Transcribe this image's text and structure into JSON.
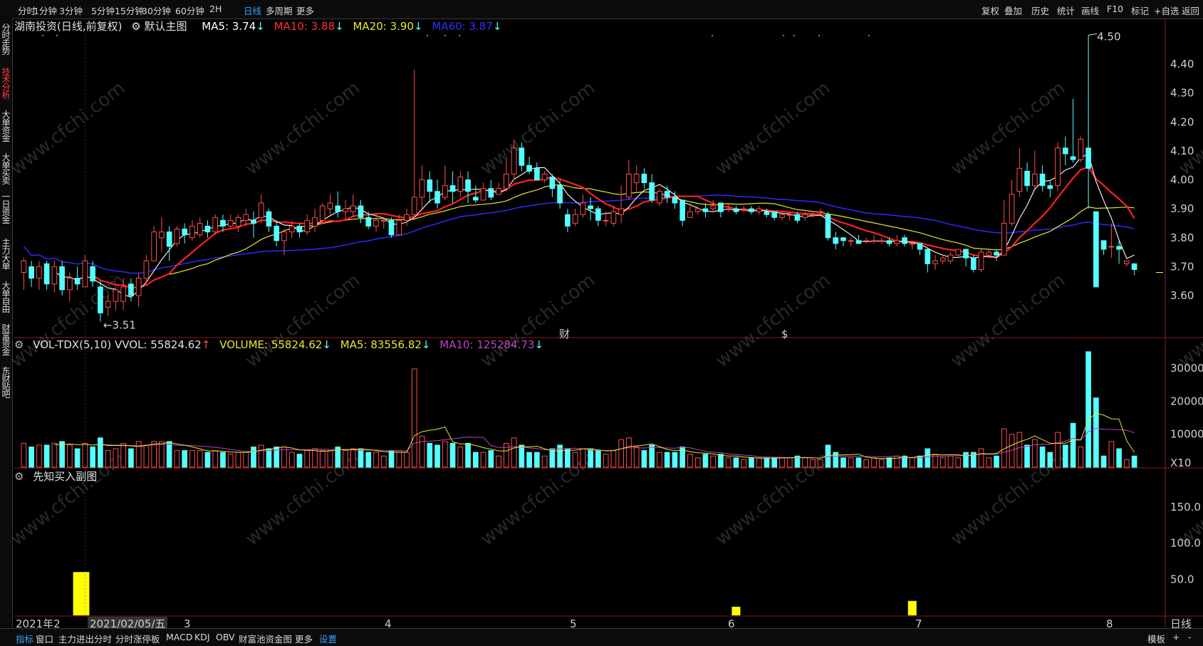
{
  "toolbar_left": [
    {
      "label": "分时",
      "active": false
    },
    {
      "label": "1分钟",
      "active": false
    },
    {
      "label": "3分钟",
      "active": false
    },
    {
      "label": "5分钟",
      "active": false
    },
    {
      "label": "15分钟",
      "active": false
    },
    {
      "label": "30分钟",
      "active": false
    },
    {
      "label": "60分钟",
      "active": false
    },
    {
      "label": "2H",
      "active": false
    },
    {
      "label": "日线",
      "active": true
    },
    {
      "label": "多周期",
      "active": false
    },
    {
      "label": "更多",
      "active": false
    }
  ],
  "toolbar_right": [
    "复权",
    "叠加",
    "历史",
    "统计",
    "画线",
    "F10",
    "标记",
    "+自选",
    "返回"
  ],
  "left_tabs": [
    {
      "label": "分时走势",
      "active": false
    },
    {
      "label": "技术分析",
      "active": true
    },
    {
      "label": "大单资金",
      "active": false
    },
    {
      "label": "大单买卖",
      "active": false
    },
    {
      "label": "一日资金",
      "active": false
    },
    {
      "label": "主力大单",
      "active": false
    },
    {
      "label": "大单自由",
      "active": false
    },
    {
      "label": "财富资金",
      "active": false
    },
    {
      "label": "东财贴吧",
      "active": false
    }
  ],
  "main_legend": {
    "stock": "湖南投资(日线,前复权)",
    "template": "默认主图",
    "ma5": "MA5: 3.74",
    "ma10": "MA10: 3.88",
    "ma20": "MA20: 3.90",
    "ma60": "MA60: 3.87"
  },
  "vol_legend": {
    "name": "VOL-TDX(5,10) VVOL: 55824.62",
    "volume": "VOLUME: 55824.62",
    "ma5": "MA5: 83556.82",
    "ma10": "MA10: 125284.73"
  },
  "sub_legend": {
    "name": "先知买入副图"
  },
  "price_axis": [
    "4.40",
    "4.30",
    "4.20",
    "4.10",
    "4.00",
    "3.90",
    "3.80",
    "3.70",
    "3.60"
  ],
  "vol_axis": [
    "30000",
    "20000",
    "10000",
    "X10"
  ],
  "sub_axis": [
    "150.0",
    "100.0",
    "50.0"
  ],
  "x_axis": [
    "2021年2",
    "2021/02/05/五",
    "3",
    "4",
    "5",
    "6",
    "7",
    "8"
  ],
  "annotations": {
    "high": "4.50",
    "low": "3.51",
    "event1": "财",
    "event2": "$"
  },
  "period_label": "日线",
  "bottom_tabs": [
    {
      "label": "指标",
      "blue": true
    },
    {
      "label": "窗口",
      "blue": false
    },
    {
      "label": "主力进出分时",
      "blue": false
    },
    {
      "label": "分时涨停板",
      "blue": false
    },
    {
      "label": "MACD",
      "blue": false
    },
    {
      "label": "KDJ",
      "blue": false
    },
    {
      "label": "OBV",
      "blue": false
    },
    {
      "label": "财富池资金图",
      "blue": false
    },
    {
      "label": "更多",
      "blue": false
    },
    {
      "label": "设置",
      "blue": true
    }
  ],
  "bottom_right": [
    "模板",
    "+",
    "-"
  ],
  "watermark": "www.cfchi.com",
  "colors": {
    "up": "#ff4d4d",
    "down": "#54ffff",
    "ma5": "#ffffff",
    "ma10": "#ff2020",
    "ma20": "#e6e62e",
    "ma60": "#2a2aff",
    "buy": "#ffff00",
    "vma10": "#c040c0"
  },
  "chart_data": {
    "type": "candlestick",
    "price_range": [
      3.51,
      4.5
    ],
    "candles": [
      [
        3.68,
        3.72,
        3.62,
        3.73
      ],
      [
        3.7,
        3.66,
        3.63,
        3.72
      ],
      [
        3.66,
        3.7,
        3.62,
        3.72
      ],
      [
        3.71,
        3.64,
        3.62,
        3.72
      ],
      [
        3.64,
        3.7,
        3.61,
        3.72
      ],
      [
        3.7,
        3.62,
        3.6,
        3.72
      ],
      [
        3.62,
        3.66,
        3.58,
        3.68
      ],
      [
        3.66,
        3.64,
        3.62,
        3.7
      ],
      [
        3.63,
        3.72,
        3.63,
        3.74
      ],
      [
        3.7,
        3.65,
        3.63,
        3.72
      ],
      [
        3.63,
        3.54,
        3.51,
        3.65
      ],
      [
        3.56,
        3.58,
        3.53,
        3.6
      ],
      [
        3.58,
        3.62,
        3.55,
        3.63
      ],
      [
        3.58,
        3.63,
        3.55,
        3.66
      ],
      [
        3.64,
        3.6,
        3.58,
        3.66
      ],
      [
        3.6,
        3.66,
        3.56,
        3.68
      ],
      [
        3.66,
        3.72,
        3.64,
        3.74
      ],
      [
        3.72,
        3.82,
        3.72,
        3.84
      ],
      [
        3.8,
        3.82,
        3.75,
        3.87
      ],
      [
        3.82,
        3.77,
        3.72,
        3.84
      ],
      [
        3.78,
        3.83,
        3.77,
        3.84
      ],
      [
        3.83,
        3.81,
        3.78,
        3.85
      ],
      [
        3.8,
        3.84,
        3.79,
        3.86
      ],
      [
        3.81,
        3.85,
        3.8,
        3.87
      ],
      [
        3.84,
        3.82,
        3.8,
        3.86
      ],
      [
        3.82,
        3.87,
        3.81,
        3.88
      ],
      [
        3.86,
        3.84,
        3.82,
        3.88
      ],
      [
        3.84,
        3.86,
        3.83,
        3.88
      ],
      [
        3.84,
        3.87,
        3.82,
        3.88
      ],
      [
        3.86,
        3.88,
        3.84,
        3.9
      ],
      [
        3.86,
        3.85,
        3.8,
        3.89
      ],
      [
        3.87,
        3.92,
        3.85,
        3.95
      ],
      [
        3.89,
        3.84,
        3.82,
        3.9
      ],
      [
        3.84,
        3.79,
        3.77,
        3.86
      ],
      [
        3.79,
        3.82,
        3.74,
        3.83
      ],
      [
        3.82,
        3.84,
        3.8,
        3.86
      ],
      [
        3.84,
        3.82,
        3.8,
        3.85
      ],
      [
        3.82,
        3.86,
        3.81,
        3.88
      ],
      [
        3.84,
        3.87,
        3.82,
        3.9
      ],
      [
        3.86,
        3.91,
        3.85,
        3.92
      ],
      [
        3.9,
        3.92,
        3.88,
        3.95
      ],
      [
        3.91,
        3.89,
        3.87,
        3.96
      ],
      [
        3.89,
        3.9,
        3.86,
        3.93
      ],
      [
        3.89,
        3.91,
        3.87,
        3.95
      ],
      [
        3.91,
        3.87,
        3.85,
        3.93
      ],
      [
        3.87,
        3.84,
        3.83,
        3.89
      ],
      [
        3.84,
        3.86,
        3.82,
        3.88
      ],
      [
        3.86,
        3.86,
        3.83,
        3.87
      ],
      [
        3.86,
        3.81,
        3.8,
        3.87
      ],
      [
        3.81,
        3.86,
        3.81,
        3.88
      ],
      [
        3.86,
        3.88,
        3.84,
        3.9
      ],
      [
        3.88,
        3.94,
        3.86,
        4.38
      ],
      [
        3.94,
        4.0,
        3.9,
        4.05
      ],
      [
        4.0,
        3.96,
        3.92,
        4.03
      ],
      [
        3.96,
        3.92,
        3.9,
        4.0
      ],
      [
        3.94,
        3.98,
        3.93,
        4.05
      ],
      [
        3.98,
        3.96,
        3.92,
        4.03
      ],
      [
        3.96,
        4.01,
        3.94,
        4.03
      ],
      [
        4.0,
        3.96,
        3.92,
        4.03
      ],
      [
        3.94,
        3.93,
        3.92,
        3.98
      ],
      [
        3.93,
        3.97,
        3.93,
        3.99
      ],
      [
        3.97,
        3.94,
        3.93,
        4.0
      ],
      [
        3.95,
        3.97,
        3.95,
        3.99
      ],
      [
        3.97,
        4.02,
        3.96,
        4.07
      ],
      [
        4.02,
        4.11,
        4.0,
        4.14
      ],
      [
        4.11,
        4.05,
        4.03,
        4.13
      ],
      [
        4.05,
        4.03,
        4.02,
        4.08
      ],
      [
        4.04,
        4.0,
        4.0,
        4.06
      ],
      [
        4.0,
        4.02,
        3.99,
        4.03
      ],
      [
        4.01,
        3.97,
        3.94,
        4.02
      ],
      [
        3.98,
        3.92,
        3.9,
        4.0
      ],
      [
        3.88,
        3.84,
        3.82,
        3.9
      ],
      [
        3.85,
        3.88,
        3.84,
        3.9
      ],
      [
        3.88,
        3.92,
        3.87,
        3.95
      ],
      [
        3.91,
        3.9,
        3.86,
        3.94
      ],
      [
        3.9,
        3.86,
        3.84,
        3.91
      ],
      [
        3.86,
        3.86,
        3.84,
        3.89
      ],
      [
        3.85,
        3.89,
        3.84,
        3.91
      ],
      [
        3.88,
        3.9,
        3.85,
        3.98
      ],
      [
        3.94,
        4.02,
        3.93,
        4.07
      ],
      [
        3.99,
        4.02,
        3.96,
        4.05
      ],
      [
        4.02,
        3.99,
        3.97,
        4.04
      ],
      [
        3.99,
        3.93,
        3.92,
        4.02
      ],
      [
        3.92,
        3.96,
        3.91,
        3.97
      ],
      [
        3.96,
        3.94,
        3.92,
        3.98
      ],
      [
        3.94,
        3.92,
        3.9,
        3.96
      ],
      [
        3.93,
        3.86,
        3.84,
        3.93
      ],
      [
        3.87,
        3.89,
        3.87,
        3.92
      ],
      [
        3.89,
        3.9,
        3.88,
        3.91
      ],
      [
        3.9,
        3.89,
        3.87,
        3.92
      ],
      [
        3.9,
        3.91,
        3.89,
        3.93
      ],
      [
        3.92,
        3.89,
        3.87,
        3.92
      ],
      [
        3.9,
        3.9,
        3.89,
        3.92
      ],
      [
        3.9,
        3.89,
        3.88,
        3.91
      ],
      [
        3.9,
        3.9,
        3.89,
        3.91
      ],
      [
        3.9,
        3.89,
        3.88,
        3.91
      ],
      [
        3.89,
        3.9,
        3.88,
        3.91
      ],
      [
        3.89,
        3.88,
        3.87,
        3.9
      ],
      [
        3.89,
        3.87,
        3.86,
        3.89
      ],
      [
        3.87,
        3.88,
        3.86,
        3.89
      ],
      [
        3.88,
        3.88,
        3.86,
        3.89
      ],
      [
        3.88,
        3.86,
        3.85,
        3.89
      ],
      [
        3.87,
        3.88,
        3.86,
        3.89
      ],
      [
        3.88,
        3.88,
        3.87,
        3.89
      ],
      [
        3.89,
        3.89,
        3.88,
        3.9
      ],
      [
        3.88,
        3.8,
        3.79,
        3.89
      ],
      [
        3.8,
        3.78,
        3.76,
        3.82
      ],
      [
        3.8,
        3.79,
        3.77,
        3.8
      ],
      [
        3.79,
        3.79,
        3.77,
        3.8
      ],
      [
        3.79,
        3.78,
        3.78,
        3.81
      ],
      [
        3.79,
        3.79,
        3.78,
        3.8
      ],
      [
        3.79,
        3.79,
        3.78,
        3.81
      ],
      [
        3.79,
        3.79,
        3.78,
        3.8
      ],
      [
        3.79,
        3.78,
        3.77,
        3.8
      ],
      [
        3.78,
        3.79,
        3.77,
        3.81
      ],
      [
        3.8,
        3.78,
        3.77,
        3.81
      ],
      [
        3.78,
        3.78,
        3.76,
        3.79
      ],
      [
        3.78,
        3.76,
        3.74,
        3.78
      ],
      [
        3.76,
        3.71,
        3.68,
        3.76
      ],
      [
        3.71,
        3.72,
        3.69,
        3.74
      ],
      [
        3.72,
        3.73,
        3.71,
        3.74
      ],
      [
        3.72,
        3.74,
        3.71,
        3.75
      ],
      [
        3.74,
        3.76,
        3.73,
        3.76
      ],
      [
        3.76,
        3.73,
        3.7,
        3.76
      ],
      [
        3.73,
        3.69,
        3.68,
        3.74
      ],
      [
        3.69,
        3.75,
        3.68,
        3.76
      ],
      [
        3.74,
        3.75,
        3.73,
        3.76
      ],
      [
        3.75,
        3.74,
        3.72,
        3.76
      ],
      [
        3.74,
        3.85,
        3.74,
        3.93
      ],
      [
        3.85,
        3.95,
        3.84,
        4.0
      ],
      [
        3.96,
        4.04,
        3.94,
        4.11
      ],
      [
        4.03,
        3.98,
        3.96,
        4.06
      ],
      [
        3.98,
        4.02,
        3.97,
        4.1
      ],
      [
        4.02,
        3.98,
        3.96,
        4.05
      ],
      [
        3.98,
        3.97,
        3.94,
        4.0
      ],
      [
        3.98,
        4.11,
        3.96,
        4.13
      ],
      [
        4.11,
        4.09,
        4.05,
        4.15
      ],
      [
        4.08,
        4.07,
        4.06,
        4.28
      ],
      [
        4.07,
        4.14,
        4.06,
        4.15
      ],
      [
        4.11,
        4.04,
        3.9,
        4.5
      ],
      [
        3.89,
        3.63,
        3.63,
        3.89
      ],
      [
        3.79,
        3.76,
        3.74,
        3.78
      ],
      [
        3.77,
        3.77,
        3.73,
        3.85
      ],
      [
        3.77,
        3.76,
        3.71,
        3.79
      ],
      [
        3.71,
        3.72,
        3.7,
        3.72
      ],
      [
        3.71,
        3.69,
        3.67,
        3.71
      ]
    ],
    "ma5_values_approx": "3.74 (last)",
    "ma10": "3.88",
    "ma20": "3.90",
    "ma60": "3.87",
    "volume_last": 55824.62,
    "buy_signals": [
      {
        "index": 7,
        "value": 60
      },
      {
        "index": 8,
        "value": 60
      },
      {
        "index": 93,
        "value": 12
      },
      {
        "index": 116,
        "value": 20
      }
    ]
  }
}
